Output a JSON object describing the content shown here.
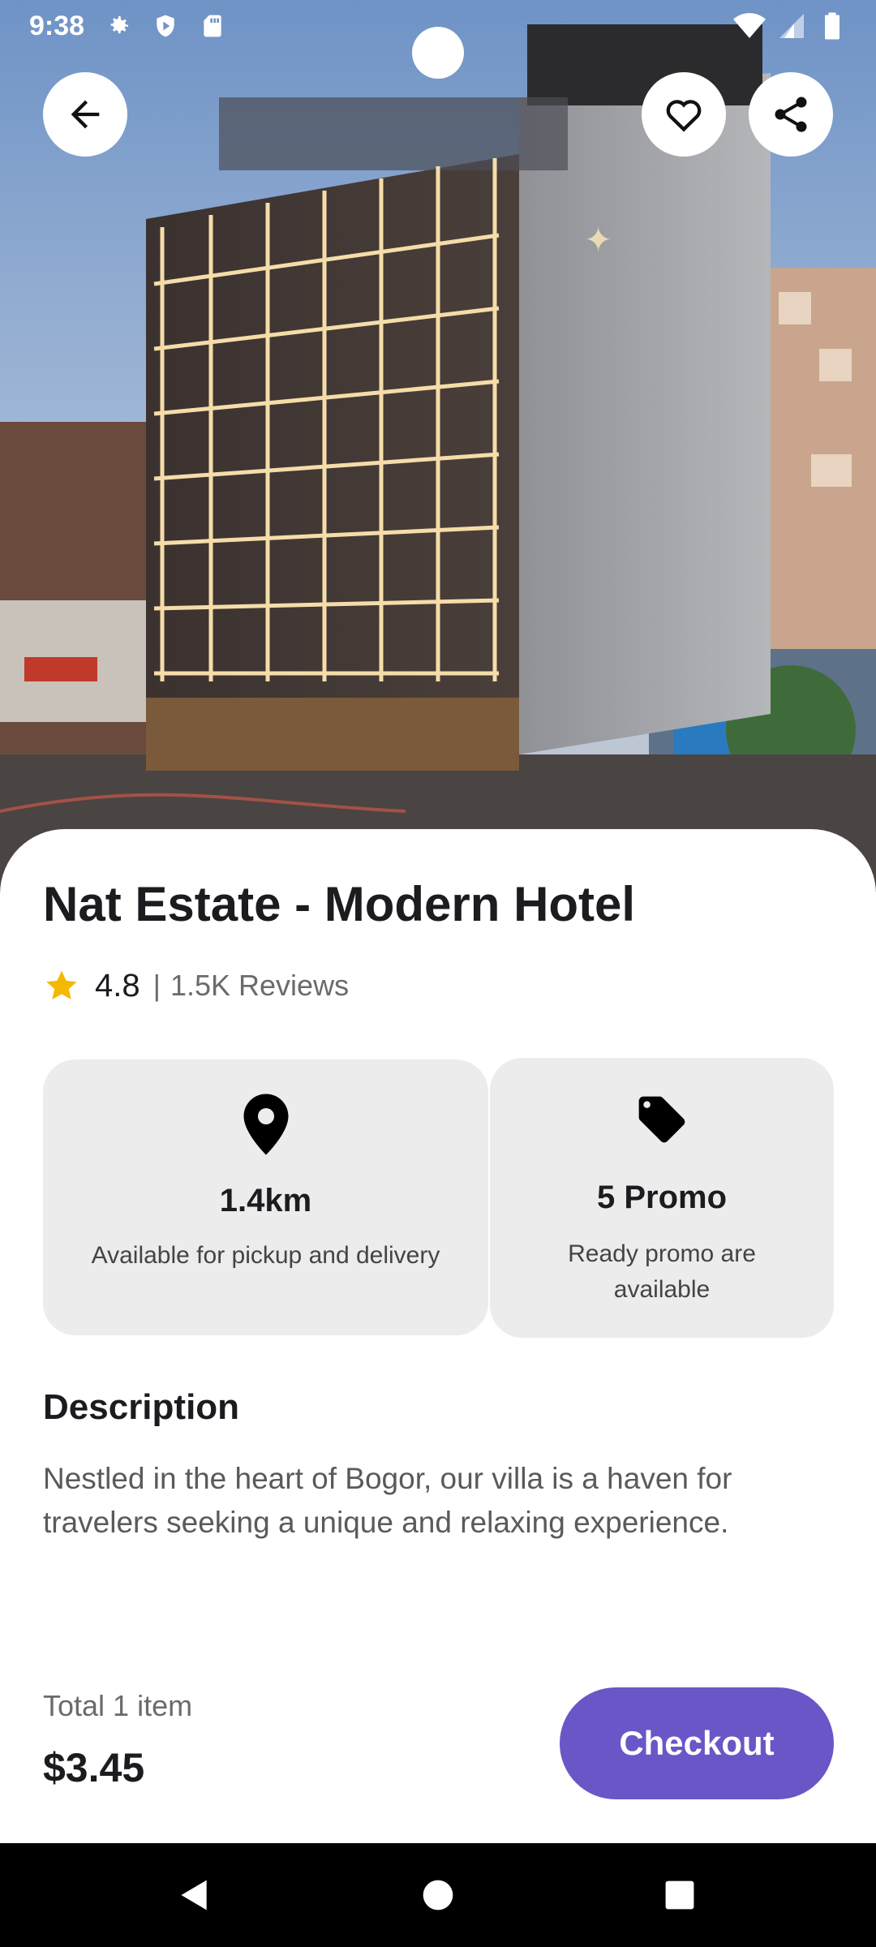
{
  "status_bar": {
    "time": "9:38",
    "left_icons": [
      "settings-icon",
      "shield-icon",
      "sd-card-icon"
    ],
    "right_icons": [
      "wifi-icon",
      "signal-icon",
      "battery-icon"
    ]
  },
  "hero": {
    "image_subject": "hotel-building-photo",
    "buttons": [
      "back-arrow-icon",
      "heart-icon",
      "share-icon"
    ]
  },
  "hotel": {
    "title": "Nat Estate - Modern Hotel",
    "rating": "4.8",
    "separator": "|",
    "reviews": "1.5K Reviews"
  },
  "cards": [
    {
      "icon": "location-pin-icon",
      "title": "1.4km",
      "subtitle": "Available for pickup and delivery"
    },
    {
      "icon": "price-tag-icon",
      "title": "5 Promo",
      "subtitle": "Ready promo are available"
    }
  ],
  "description": {
    "heading": "Description",
    "text": "Nestled in the heart of Bogor, our villa is a haven for travelers seeking a unique and relaxing experience."
  },
  "footer": {
    "total_label": "Total 1 item",
    "total_price": "$3.45",
    "checkout_label": "Checkout"
  },
  "colors": {
    "accent": "#6a56c6",
    "card_bg": "#ececec",
    "star": "#f5b800"
  }
}
